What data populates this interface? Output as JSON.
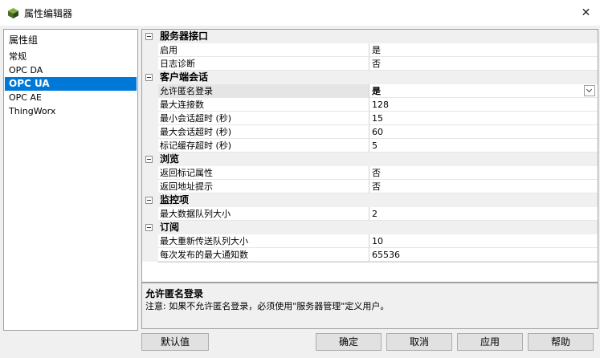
{
  "window": {
    "title": "属性编辑器",
    "close_glyph": "✕"
  },
  "groups": {
    "header": "属性组",
    "items": [
      {
        "label": "常规"
      },
      {
        "label": "OPC DA"
      },
      {
        "label": "OPC UA",
        "selected": true
      },
      {
        "label": "OPC AE"
      },
      {
        "label": "ThingWorx"
      }
    ]
  },
  "grid": {
    "categories": [
      {
        "label": "服务器接口",
        "rows": [
          {
            "name": "启用",
            "value": "是"
          },
          {
            "name": "日志诊断",
            "value": "否"
          }
        ]
      },
      {
        "label": "客户端会话",
        "rows": [
          {
            "name": "允许匿名登录",
            "value": "是"
          },
          {
            "name": "最大连接数",
            "value": "128"
          },
          {
            "name": "最小会话超时 (秒)",
            "value": "15"
          },
          {
            "name": "最大会话超时 (秒)",
            "value": "60"
          },
          {
            "name": "标记缓存超时 (秒)",
            "value": "5"
          }
        ]
      },
      {
        "label": "浏览",
        "rows": [
          {
            "name": "返回标记属性",
            "value": "否"
          },
          {
            "name": "返回地址提示",
            "value": "否"
          }
        ]
      },
      {
        "label": "监控项",
        "rows": [
          {
            "name": "最大数据队列大小",
            "value": "2"
          }
        ]
      },
      {
        "label": "订阅",
        "rows": [
          {
            "name": "最大重新传送队列大小",
            "value": "10"
          },
          {
            "name": "每次发布的最大通知数",
            "value": "65536"
          }
        ]
      }
    ]
  },
  "description": {
    "title": "允许匿名登录",
    "text": "注意: 如果不允许匿名登录，必须使用\"服务器管理\"定义用户。"
  },
  "buttons": {
    "defaults": "默认值",
    "ok": "确定",
    "cancel": "取消",
    "apply": "应用",
    "help": "帮助"
  }
}
